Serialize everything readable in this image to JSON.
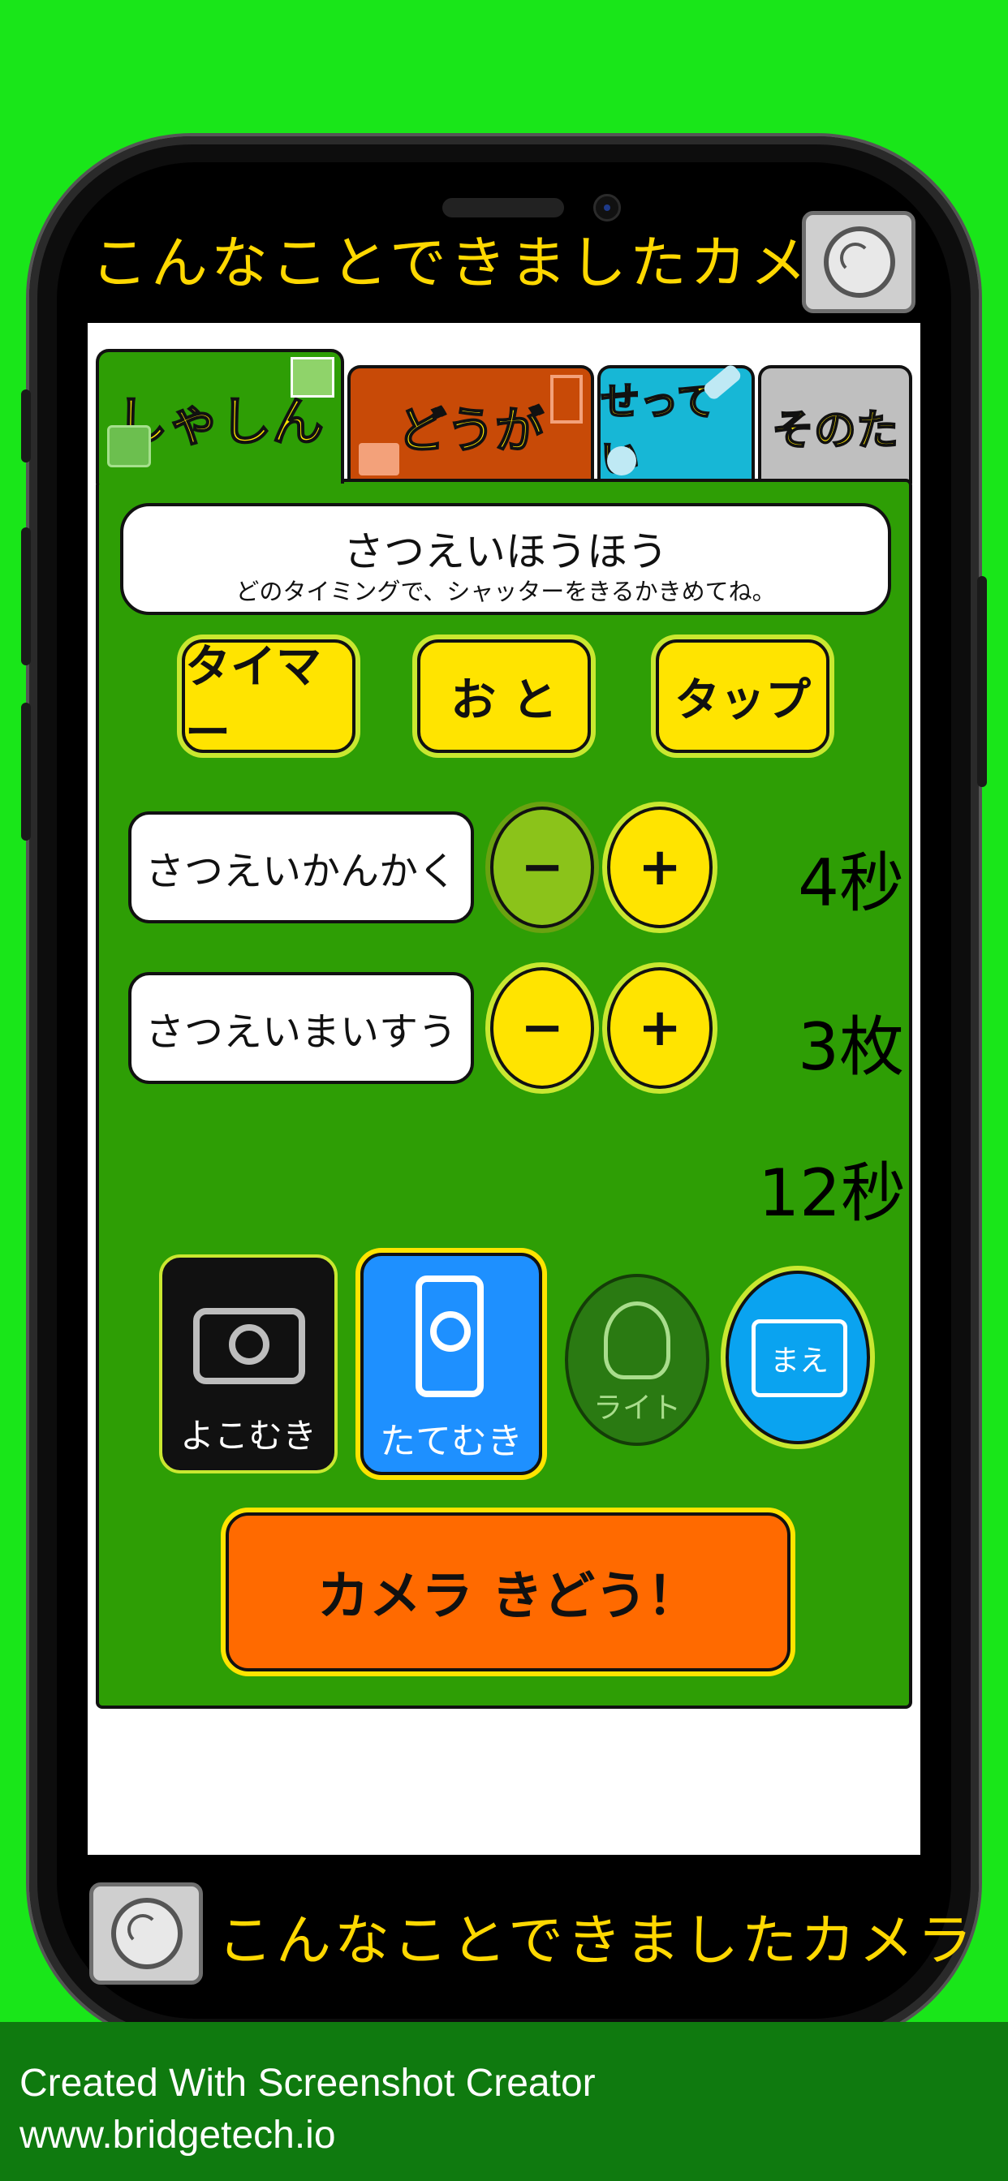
{
  "app": {
    "top_banner": "こんなことできましたカメラ",
    "bottom_banner": "こんなことできましたカメラ"
  },
  "tabs": [
    {
      "label": "しゃしん",
      "selected": true,
      "color": "#2e9e05"
    },
    {
      "label": "どうが",
      "selected": false,
      "color": "#c84a07"
    },
    {
      "label": "せってい",
      "selected": false,
      "color": "#17b7d6"
    },
    {
      "label": "そのた",
      "selected": false,
      "color": "#bfbfbf"
    }
  ],
  "method": {
    "title": "さつえいほうほう",
    "subtitle": "どのタイミングで、シャッターをきるかきめてね。",
    "options": [
      "タイマー",
      "お と",
      "タップ"
    ]
  },
  "interval": {
    "label": "さつえいかんかく",
    "minus": "−",
    "plus": "+",
    "value": "4秒"
  },
  "count": {
    "label": "さつえいまいすう",
    "minus": "−",
    "plus": "+",
    "value": "3枚"
  },
  "total": {
    "value": "12秒"
  },
  "orientation": {
    "landscape_label": "よこむき",
    "portrait_label": "たてむき",
    "light_label": "ライト",
    "front_label": "まえ"
  },
  "launch_button": "カメラ きどう！",
  "footer": {
    "line1": "Created With Screenshot Creator",
    "line2": "www.bridgetech.io"
  },
  "colors": {
    "background": "#19e619",
    "panel": "#2e9e05",
    "accent_yellow": "#ffe400",
    "launch_orange": "#ff6a00",
    "portrait_blue": "#1e90ff"
  }
}
